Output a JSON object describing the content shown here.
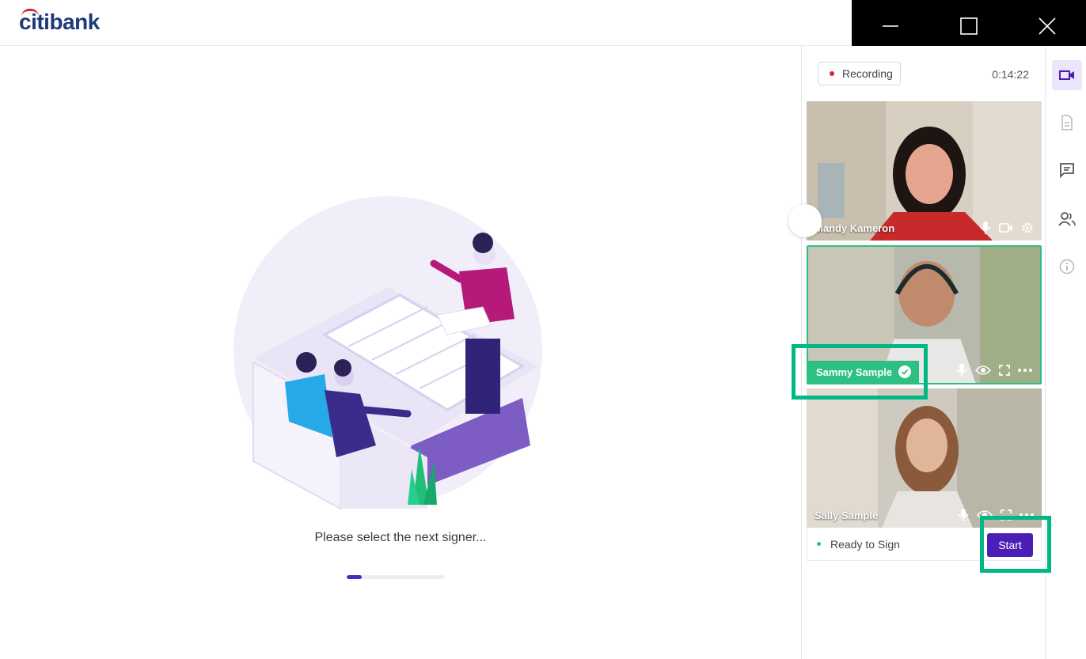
{
  "app": {
    "logo_text": "citibank"
  },
  "window": {
    "minimize": "minimize",
    "maximize": "maximize",
    "close": "close"
  },
  "main": {
    "status_text": "Please select the next signer...",
    "progress_fraction": 0.15
  },
  "panel": {
    "recording_label": "Recording",
    "timer": "0:14:22",
    "participants": [
      {
        "name": "Mandy Kameron"
      },
      {
        "name": "Sammy Sample"
      },
      {
        "name": "Sally Sample",
        "status": "Ready to Sign",
        "action_label": "Start"
      }
    ]
  },
  "colors": {
    "brand_blue": "#1f3a7a",
    "brand_red": "#d7282f",
    "accent_purple": "#4b1fb5",
    "active_green": "#2ec083",
    "highlight_green": "#00b884"
  },
  "icons": {
    "rail": [
      "video-icon",
      "document-icon",
      "chat-icon",
      "people-icon",
      "info-icon"
    ],
    "tile_host": [
      "mic-icon",
      "camera-icon",
      "gear-icon"
    ],
    "tile_signer": [
      "mic-icon",
      "eye-icon",
      "fullscreen-icon",
      "more-icon"
    ]
  }
}
